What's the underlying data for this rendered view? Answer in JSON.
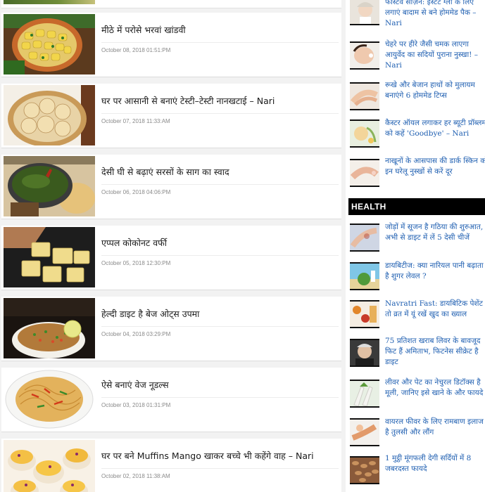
{
  "articles": [
    {
      "title": "मीठे में परोसे भरवां खांडवी",
      "date": "October 08, 2018 01:51:PM"
    },
    {
      "title": "घर पर आसानी से बनाएं टेस्टी–टेस्टी नानखटाई – Nari",
      "date": "October 07, 2018 11:33:AM"
    },
    {
      "title": "देसी घी से बढ़ाएं सरसों के साग का स्वाद",
      "date": "October 06, 2018 04:06:PM"
    },
    {
      "title": "एप्पल कोकोनट वर्फी",
      "date": "October 05, 2018 12:30:PM"
    },
    {
      "title": "हेल्दी डाइट है बेज ओट्स उपमा",
      "date": "October 04, 2018 03:29:PM"
    },
    {
      "title": "ऐसे बनाएं वेज नूडल्स",
      "date": "October 03, 2018 01:31:PM"
    },
    {
      "title": "घर पर बने Muffins Mango खाकर बच्चे भी कहेंगे वाह – Nari",
      "date": "October 02, 2018 11:38:AM"
    }
  ],
  "sidebar": {
    "beauty_items": [
      {
        "title": "फेस्टिव सीज़न: इंस्टेंट ग्लो के लिए लगाएं बादाम से बने होममेड पैक – Nari"
      },
      {
        "title": "चेहरे पर हीरे जैसी चमक लाएगा आयुर्वेद का सदियों पुराना नुस्खा! – Nari"
      },
      {
        "title": "रूखे और बेजान हाथों को मुलायम बनाएंगे 6 होममेड टिप्स"
      },
      {
        "title": "कैस्टर ऑयल लगाकर हर ब्यूटी प्रॉब्लम को कहें 'Goodbye' – Nari"
      },
      {
        "title": "नाखूनों के आसपास की डार्क स्किन को इन घरेलू नुस्खों से करें दूर"
      }
    ],
    "health_heading": "HEALTH",
    "health_items": [
      {
        "title": "जोड़ों में सूजन है गठिया की शुरुआत, अभी से डाइट में लें 5 देसी चीजें"
      },
      {
        "title": "डायबिटीज: क्या नारियल पानी बढ़ाता है शुगर लेवल ?"
      },
      {
        "title": "Navratri Fast: डायबिटिक पेशेंट हैं तो व्रत में यूं रखें खुद का ख्याल"
      },
      {
        "title": "75 प्रतिशत खराब लिवर के बावजूद फिट हैं अमिताभ, फिटनेस सीक्रेट है डाइट"
      },
      {
        "title": "लीवर और पेट का नेचुरल डिटॉक्स है मूली, जानिए इसे खाने के और फायदे"
      },
      {
        "title": "वायरल फीवर के लिए रामबाण इलाज है तुलसी और लौंग"
      },
      {
        "title": "1 मुट्ठी मूंगफली देगी सर्दियों में 8 जबरदस्त फायदे"
      }
    ]
  }
}
